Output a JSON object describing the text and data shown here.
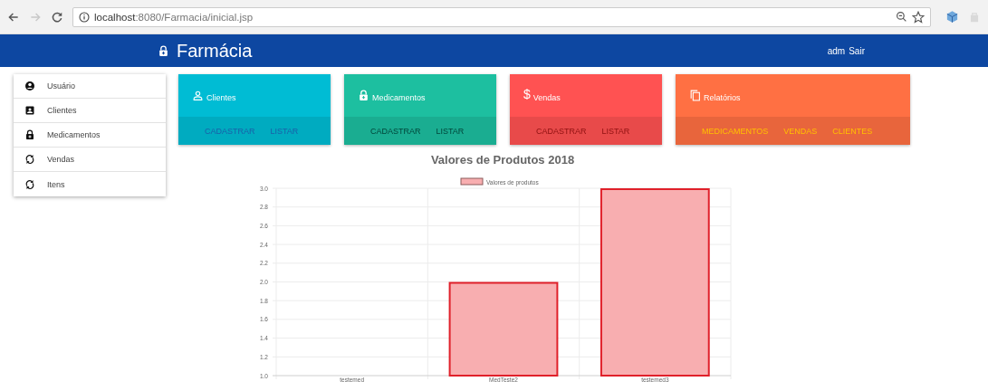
{
  "browser": {
    "url_host": "localhost",
    "url_path": ":8080/Farmacia/inicial.jsp",
    "forward_disabled": true
  },
  "header": {
    "title": "Farmácia",
    "user": "adm",
    "logout": "Sair"
  },
  "sidebar": {
    "items": [
      {
        "label": "Usuário"
      },
      {
        "label": "Clientes"
      },
      {
        "label": "Medicamentos"
      },
      {
        "label": "Vendas"
      },
      {
        "label": "Itens"
      }
    ]
  },
  "cards": [
    {
      "title": "Clientes",
      "color": "#00bcd4",
      "actions": [
        "CADASTRAR",
        "LISTAR"
      ]
    },
    {
      "title": "Medicamentos",
      "color": "#1dbfa0",
      "actions": [
        "CADASTRAR",
        "LISTAR"
      ]
    },
    {
      "title": "Vendas",
      "icon_text": "$",
      "color": "#ff5252",
      "actions": [
        "CADASTRAR",
        "LISTAR"
      ]
    },
    {
      "title": "Relatórios",
      "color": "#ff7043",
      "actions": [
        "MEDICAMENTOS",
        "VENDAS",
        "CLIENTES"
      ]
    }
  ],
  "chart": {
    "chart_data": {
      "type": "bar",
      "title": "Valores de Produtos 2018",
      "categories": [
        "testemed",
        "MedTeste2",
        "testemed3"
      ],
      "series": [
        {
          "name": "Valores de produtos",
          "color": "#f8aeb0",
          "values": [
            1,
            2,
            3
          ]
        }
      ],
      "ylim": [
        1,
        3
      ],
      "grid": true,
      "yticks": [
        {
          "value": 1,
          "label": "1.0"
        },
        {
          "value": 1.2,
          "label": "1.2"
        },
        {
          "value": 1.4,
          "label": "1.4"
        },
        {
          "value": 1.6,
          "label": "1.6"
        },
        {
          "value": 1.8,
          "label": "1.8"
        },
        {
          "value": 2,
          "label": "2.0"
        },
        {
          "value": 2.2,
          "label": "2.2"
        },
        {
          "value": 2.4,
          "label": "2.4"
        },
        {
          "value": 2.6,
          "label": "2.6"
        },
        {
          "value": 2.8,
          "label": "2.8"
        },
        {
          "value": 3,
          "label": "3.0"
        }
      ]
    }
  }
}
